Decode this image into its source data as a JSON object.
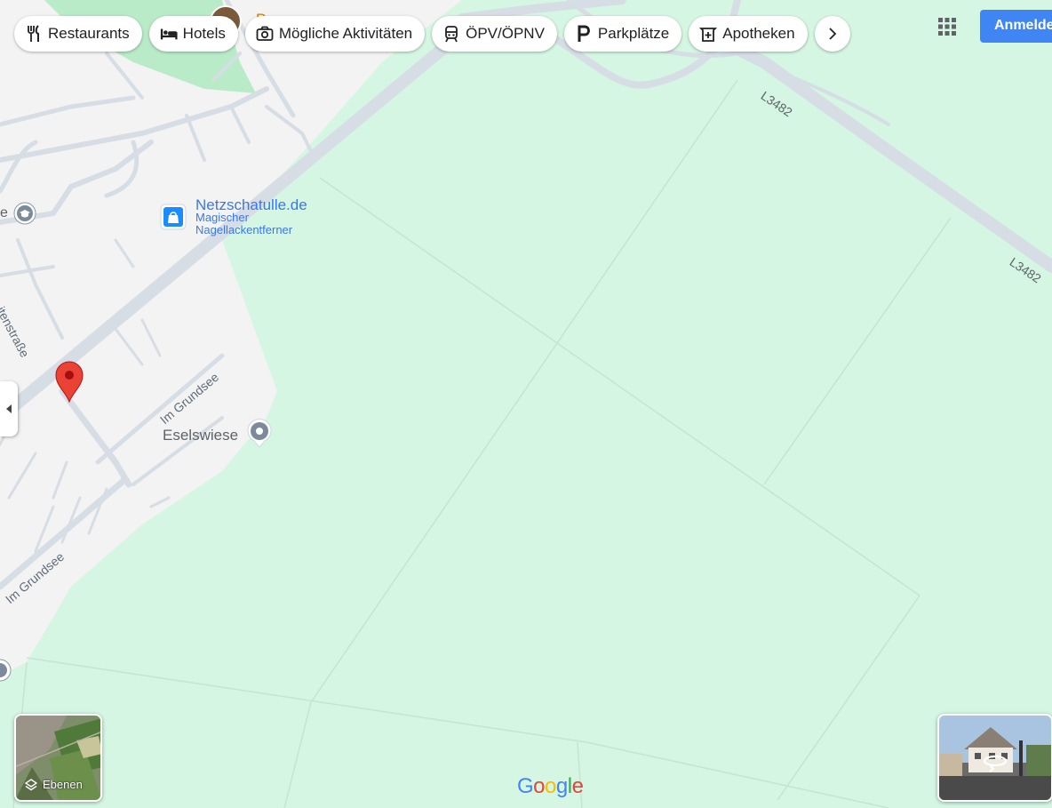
{
  "categories": [
    {
      "label": "Restaurants",
      "icon": "fork-knife-icon"
    },
    {
      "label": "Hotels",
      "icon": "bed-icon"
    },
    {
      "label": "Mögliche Aktivitäten",
      "icon": "camera-icon"
    },
    {
      "label": "ÖPV/ÖPNV",
      "icon": "train-icon"
    },
    {
      "label": "Parkplätze",
      "icon": "parking-icon"
    },
    {
      "label": "Apotheken",
      "icon": "pharmacy-icon"
    }
  ],
  "header": {
    "signin_label": "Anmelden",
    "apps_icon": "google-apps-grid-icon",
    "partial_poi_letter": "P"
  },
  "map": {
    "pois": {
      "netzschatulle_name": "Netzschatulle.de",
      "netzschatulle_sub1": "Magischer",
      "netzschatulle_sub2": "Nagellackentferner",
      "eselswiese": "Eselswiese"
    },
    "streets": {
      "im_grundsee_1": "Im Grundsee",
      "im_grundsee_2": "Im Grundsee",
      "partial_street": "itenstraße",
      "road_l3482_a": "L3482",
      "road_l3482_b": "L3482",
      "partial_edge_letter": "e"
    },
    "colors": {
      "field": "#d4f6e2",
      "urban": "#f3f3f3",
      "park": "#b9ebc8",
      "road": "#d6dde5",
      "pin": "#ea4335"
    }
  },
  "controls": {
    "layers_label": "Ebenen",
    "logo": [
      "G",
      "o",
      "o",
      "g",
      "l",
      "e"
    ],
    "logo_colors": [
      "#4285f4",
      "#ea4335",
      "#fbbc05",
      "#4285f4",
      "#34a853",
      "#ea4335"
    ]
  }
}
